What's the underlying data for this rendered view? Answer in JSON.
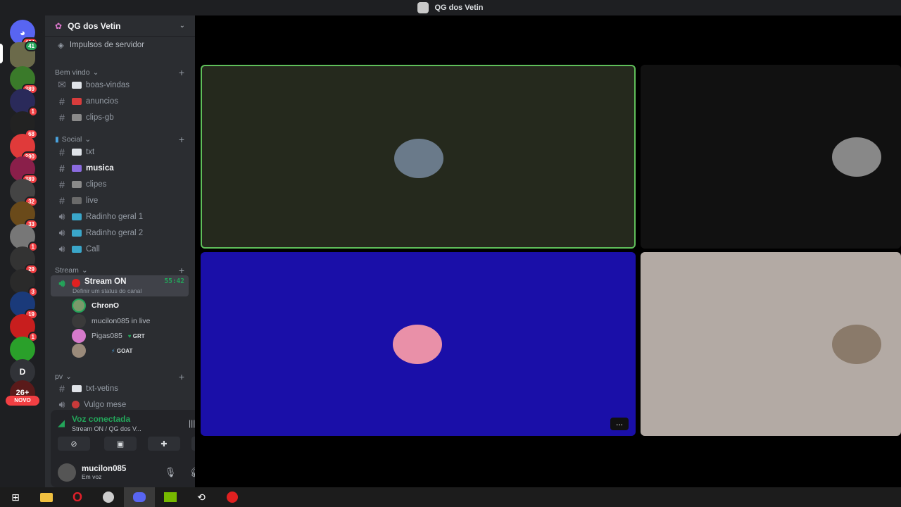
{
  "window": {
    "title": "QG dos Vetin"
  },
  "rail": {
    "badges": [
      "464",
      "41",
      "389",
      "1",
      "68",
      "290",
      "389",
      "32",
      "33",
      "1",
      "29",
      "3",
      "19",
      "1"
    ],
    "dm_letter": "D",
    "event_label": "26+",
    "novo_label": "NOVO"
  },
  "sidebar": {
    "guild_name": "QG dos Vetin",
    "boost_label": "Impulsos de servidor",
    "categories": {
      "bemvindo": "Bem vindo",
      "social": "Social",
      "stream": "Stream",
      "pv": "pv"
    },
    "channels": {
      "boas_vindas": "boas-vindas",
      "anuncios": "anuncios",
      "clips_gb": "clips-gb",
      "txt": "txt",
      "musica": "musica",
      "clipes": "clipes",
      "live": "live",
      "radinho1": "Radinho geral 1",
      "radinho2": "Radinho geral 2",
      "call": "Call",
      "stream_on": "Stream ON",
      "stream_timer": "55:42",
      "stream_status": "Definir um status do canal",
      "txt_vetins": "txt-vetins",
      "vulgo_mese": "Vulgo mese"
    },
    "voice_users": [
      {
        "name": "ChronO",
        "tag": ""
      },
      {
        "name": "mucilon085 in live",
        "tag": ""
      },
      {
        "name": "Pigas085",
        "tag": "GRT"
      },
      {
        "name": "",
        "tag": "GOAT"
      }
    ]
  },
  "voice": {
    "status": "Voz conectada",
    "location": "Stream ON / QG dos V...",
    "username": "mucilon085",
    "user_status": "Em voz"
  },
  "colors": {
    "speaking_border": "#5fbf5a",
    "tile_green": "#25291d",
    "tile_dark": "#111111",
    "tile_blue": "#1a0fa8",
    "tile_beige": "#b3aaa4"
  },
  "stage": {
    "more_label": "..."
  }
}
